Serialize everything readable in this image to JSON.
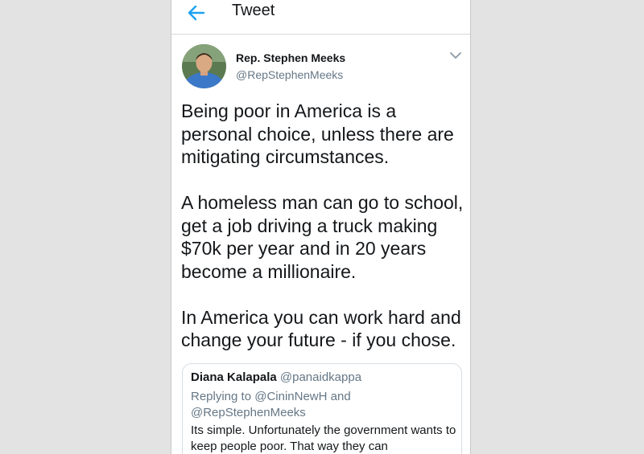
{
  "header": {
    "title": "Tweet",
    "back_icon": "arrow-left-icon",
    "accent": "#1da1f2"
  },
  "tweet": {
    "author_name": "Rep. Stephen Meeks",
    "author_handle": "@RepStephenMeeks",
    "menu_icon": "chevron-down-icon",
    "paragraphs": [
      "Being poor in America is a personal choice, unless there are mitigating circumstances.",
      "A homeless man can go to school, get a job driving a truck making $70k per year and in 20 years become a millionaire.",
      "In America you can work hard and change your future - if you chose."
    ]
  },
  "quoted": {
    "author_name": "Diana Kalapala",
    "author_handle": "@panaidkappa",
    "replying_to": "Replying to @CininNewH and @RepStephenMeeks",
    "text": "Its simple. Unfortunately the government wants to keep people poor.  That way they can"
  }
}
